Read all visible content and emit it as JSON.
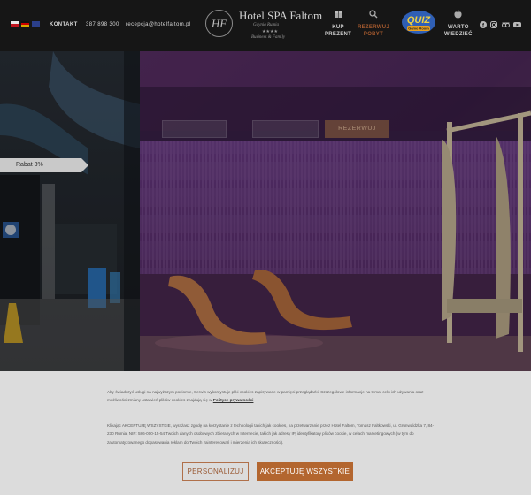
{
  "header": {
    "languages": [
      "pl",
      "de",
      "en"
    ],
    "contact_label": "KONTAKT",
    "phone": "387 898 300",
    "email": "recepcja@hotelfaltom.pl",
    "logo": {
      "monogram": "HF",
      "title": "Hotel SPA Faltom",
      "subtitle": "Gdynia Rumia",
      "stars": "★★★★",
      "tagline": "Business & Family"
    },
    "nav": [
      {
        "icon": "gift-icon",
        "label": [
          "KUP",
          "PREZENT"
        ],
        "accent": false
      },
      {
        "icon": "search-icon",
        "label": [
          "REZERWUJ",
          "POBYT"
        ],
        "accent": true
      },
      {
        "icon": "quiz-logo",
        "label": [
          "QUIZ",
          "Game Room"
        ],
        "accent": false
      },
      {
        "icon": "apple-icon",
        "label": [
          "WARTO",
          "WIEDZIEĆ"
        ],
        "accent": false
      }
    ],
    "social": [
      "facebook-icon",
      "instagram-icon",
      "tripadvisor-icon",
      "youtube-icon"
    ]
  },
  "hero": {
    "booking": {
      "button_label": "REZERWUJ"
    },
    "badge": "Rabat 3%"
  },
  "cookie": {
    "para1": "Aby świadczyć usługi na najwyższym poziomie, Serwis wykorzystuje pliki cookies zapisywane w pamięci przeglądarki. Szczegółowe informacje na temat celu ich używania oraz możliwości zmiany ustawień plików cookies znajdują się w",
    "para1_link": "Polityce prywatności",
    "para2": "Klikając AKCEPTUJĘ WSZYSTKIE, wyrażasz zgodę na korzystanie z technologii takich jak cookies, na przetwarzanie przez Hotel Faltom, Tomasz Faltkowski, ul. Grunwaldzka 7, 84-230 Rumia, NIP: 586-000-15-54 Twoich danych osobowych zbieranych w Internecie, takich jak adresy IP, identyfikatory plików cookie, w celach marketingowych (w tym do zautomatyzowanego dopasowania reklam do Twoich zainteresowań i mierzenia ich skuteczności).",
    "btn_personalize": "PERSONALIZUJ",
    "btn_accept": "AKCEPTUJĘ WSZYSTKIE"
  },
  "colors": {
    "accent": "#b3662f",
    "header_bg": "#161616",
    "cookie_bg": "#dcdcdc"
  }
}
